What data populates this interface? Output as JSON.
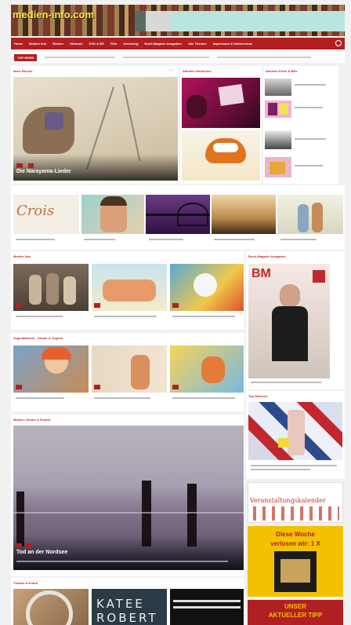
{
  "site": {
    "logo": "medien-info.com"
  },
  "nav": {
    "items": [
      "Home",
      "Medien Info",
      "Bücher",
      "Hörbuch",
      "DVD & BD",
      "Film",
      "Verlosung",
      "Buch-Magazin Ausgaben",
      "Alle Themen",
      "Impressum & Datenschutz"
    ]
  },
  "ticker": {
    "badge": "TOP NEWS"
  },
  "section1": {
    "title": "Neue Bücher",
    "featured_title": "Die Narayama-Lieder"
  },
  "section2": {
    "title": "Aktuelle Hörbücher"
  },
  "section3": {
    "title": "Aktuelle DVDs & BDs"
  },
  "section4": {
    "title": "Medien Neu"
  },
  "section5": {
    "title": "Buch-Magazin Ausgaben"
  },
  "section6": {
    "title": "Jugendbücher · Kinder & Jugend"
  },
  "section7": {
    "title": "Medien: Kinder & Familie",
    "featured_title": "Tod an der Nordsee"
  },
  "section8": {
    "title": "Theater & Kultur"
  },
  "sidebar": {
    "title": "Top Hörbuch",
    "calendar": "Veranstaltungskalender",
    "weekly_line1": "Diese Woche",
    "weekly_line2": "verlosen wir: 1 X",
    "tip_line1": "UNSER",
    "tip_line2": "AKTUELLER TIPP"
  },
  "book_covers": {
    "katee": "KATEE",
    "robert": "ROBERT"
  },
  "colors": {
    "accent": "#b11f23",
    "header_bg": "#6b4a32",
    "logo": "#f5e64a",
    "calendar": "#c0392b",
    "tip_bg": "#f2c200"
  }
}
